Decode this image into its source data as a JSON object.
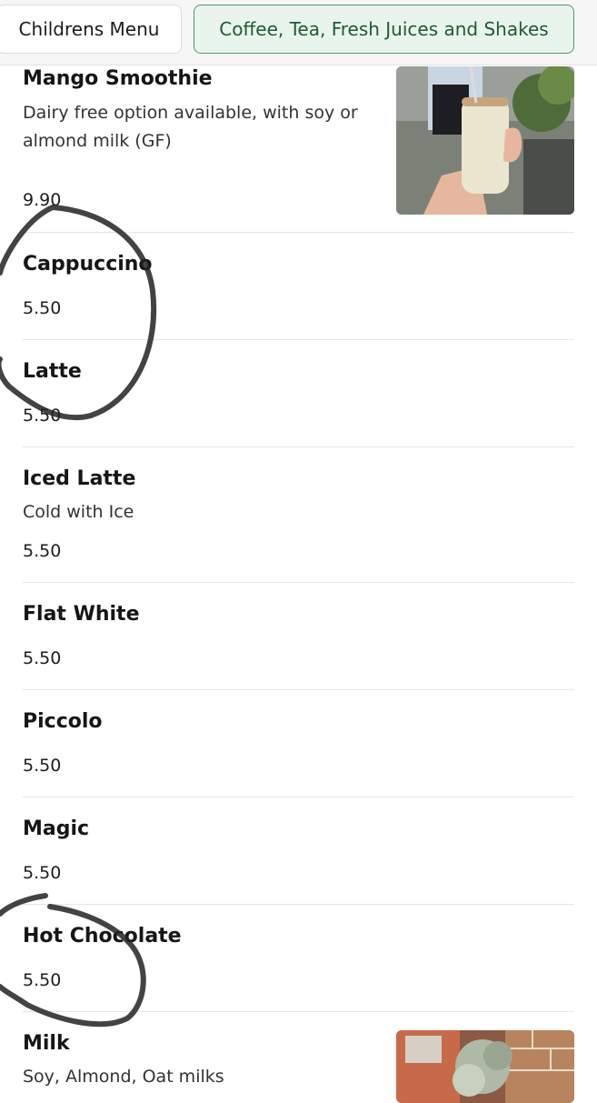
{
  "tabs": [
    {
      "label": "Childrens Menu"
    },
    {
      "label": "Coffee, Tea, Fresh Juices and Shakes"
    }
  ],
  "items": [
    {
      "name": "Mango Smoothie",
      "description": "Dairy free option available, with soy or\nalmond milk (GF)",
      "price": "9.90"
    },
    {
      "name": "Cappuccino",
      "price": "5.50"
    },
    {
      "name": "Latte",
      "price": "5.50"
    },
    {
      "name": "Iced Latte",
      "description": "Cold with Ice",
      "price": "5.50"
    },
    {
      "name": "Flat White",
      "price": "5.50"
    },
    {
      "name": "Piccolo",
      "price": "5.50"
    },
    {
      "name": "Magic",
      "price": "5.50"
    },
    {
      "name": "Hot Chocolate",
      "price": "5.50"
    },
    {
      "name": "Milk",
      "description": "Soy, Almond, Oat milks"
    }
  ]
}
